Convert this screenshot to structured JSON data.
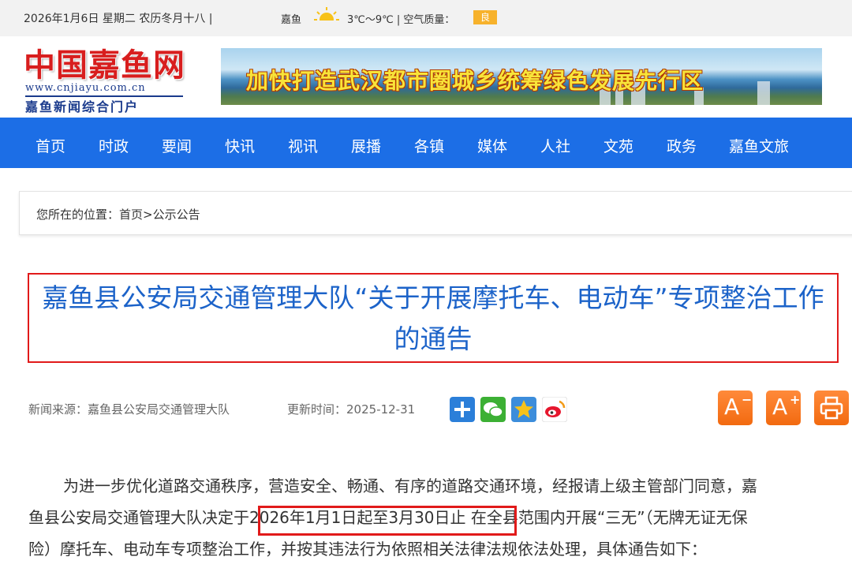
{
  "topbar": {
    "date": "2026年1月6日 星期二 农历冬月十八  |",
    "city": "嘉鱼",
    "weather_icon": "sun-icon",
    "temp": "3℃～9℃ | 空气质量：",
    "aq_label": "",
    "aq_value": "良"
  },
  "logo": {
    "name": "中国嘉鱼网",
    "url": "www.cnjiayu.com.cn",
    "tagline": "嘉鱼新闻综合门户"
  },
  "banner": {
    "slogan": "加快打造武汉都市圈城乡统筹绿色发展先行区"
  },
  "nav": {
    "items": [
      "首页",
      "时政",
      "要闻",
      "快讯",
      "视讯",
      "展播",
      "各镇",
      "媒体",
      "人社",
      "文苑",
      "政务",
      "嘉鱼文旅"
    ]
  },
  "breadcrumb": {
    "text": "您所在的位置：首页>公示公告"
  },
  "article": {
    "title": "嘉鱼县公安局交通管理大队“关于开展摩托车、电动车”专项整治工作的通告",
    "source": "新闻来源：嘉鱼县公安局交通管理大队",
    "updated": "更新时间：2025-12-31",
    "share_icons": [
      "add-share-icon",
      "wechat-icon",
      "qzone-star-icon",
      "weibo-icon"
    ],
    "tools": {
      "font_smaller": "A",
      "font_larger": "A",
      "print_icon": "print-icon"
    },
    "paragraph_lines": [
      "为进一步优化道路交通秩序，营造安全、畅通、有序的道路交通环境，经报请上级主管部门同意，嘉",
      "鱼县公安局交通管理大队决定于2026年1月1日起至3月30日止   在全县范围内开展“三无”（无牌无证无保",
      "险）摩托车、电动车专项整治工作，并按其违法行为依照相关法律法规依法处理，具体通告如下："
    ]
  },
  "colors": {
    "nav_bg": "#1c6ee6",
    "title": "#1c63c9",
    "highlight_border": "#e11a1a",
    "tool_orange": "#f26a10"
  }
}
